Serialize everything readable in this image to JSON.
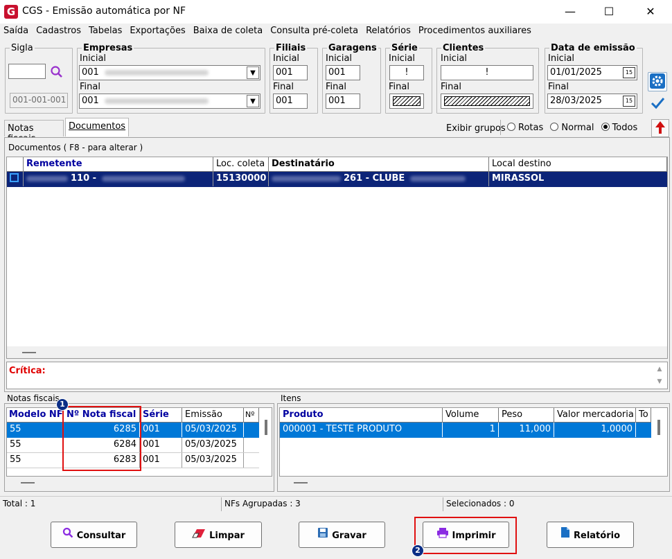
{
  "window": {
    "title": "CGS - Emissão automática por NF",
    "logo": "G",
    "minimize": "—",
    "maximize": "☐",
    "close": "✕"
  },
  "menu": [
    "Saída",
    "Cadastros",
    "Tabelas",
    "Exportações",
    "Baixa de coleta",
    "Consulta pré-coleta",
    "Relatórios",
    "Procedimentos auxiliares"
  ],
  "filters": {
    "sigla": {
      "legend": "Sigla",
      "value": "",
      "code": "001-001-001"
    },
    "empresas": {
      "legend": "Empresas",
      "inicial_label": "Inicial",
      "inicial": "001",
      "final_label": "Final",
      "final": "001"
    },
    "filiais": {
      "legend": "Filiais",
      "inicial_label": "Inicial",
      "inicial": "001",
      "final_label": "Final",
      "final": "001"
    },
    "garagens": {
      "legend": "Garagens",
      "inicial_label": "Inicial",
      "inicial": "001",
      "final_label": "Final",
      "final": "001"
    },
    "serie": {
      "legend": "Série",
      "inicial_label": "Inicial",
      "inicial": "!",
      "final_label": "Final"
    },
    "clientes": {
      "legend": "Clientes",
      "inicial_label": "Inicial",
      "inicial": "!",
      "final_label": "Final"
    },
    "data": {
      "legend": "Data de emissão",
      "inicial_label": "Inicial",
      "inicial": "01/01/2025",
      "final_label": "Final",
      "final": "28/03/2025",
      "cal": "15"
    }
  },
  "tabs": [
    "Notas fiscais",
    "Documentos"
  ],
  "groups": {
    "label": "Exibir grupos",
    "options": [
      "Rotas",
      "Normal",
      "Todos"
    ],
    "selected": "Todos"
  },
  "documentos": {
    "title": "Documentos ( F8 - para alterar )",
    "columns": [
      "Remetente",
      "Loc. coleta",
      "Destinatário",
      "Local destino"
    ],
    "row": {
      "remetente": "110 -",
      "loc_coleta": "15130000",
      "destinatario": "261 - CLUBE",
      "local_destino": "MIRASSOL"
    }
  },
  "critica_label": "Crítica:",
  "notas": {
    "title": "Notas fiscais",
    "columns": [
      "Modelo NF",
      "Nº Nota fiscal",
      "Série",
      "Emissão",
      "Nº"
    ],
    "rows": [
      {
        "modelo": "55",
        "numero": "6285",
        "serie": "001",
        "emissao": "05/03/2025"
      },
      {
        "modelo": "55",
        "numero": "6284",
        "serie": "001",
        "emissao": "05/03/2025"
      },
      {
        "modelo": "55",
        "numero": "6283",
        "serie": "001",
        "emissao": "05/03/2025"
      }
    ]
  },
  "itens": {
    "title": "Itens",
    "columns": [
      "Produto",
      "Volume",
      "Peso",
      "Valor mercadoria",
      "To"
    ],
    "row": {
      "produto": "000001 - TESTE PRODUTO",
      "volume": "1",
      "peso": "11,000",
      "valor": "1,0000"
    }
  },
  "status": {
    "total": "Total : 1",
    "agrupadas": "NFs Agrupadas : 3",
    "selecionados": "Selecionados : 0"
  },
  "buttons": {
    "consultar": "Consultar",
    "limpar": "Limpar",
    "gravar": "Gravar",
    "imprimir": "Imprimir",
    "relatorio": "Relatório"
  },
  "badges": [
    "1",
    "2"
  ],
  "colors": {
    "selection": "#0c2478",
    "row_selected": "#0078d7",
    "header_text": "#0000a0",
    "critica": "#e00000",
    "annotation": "#e01010"
  }
}
